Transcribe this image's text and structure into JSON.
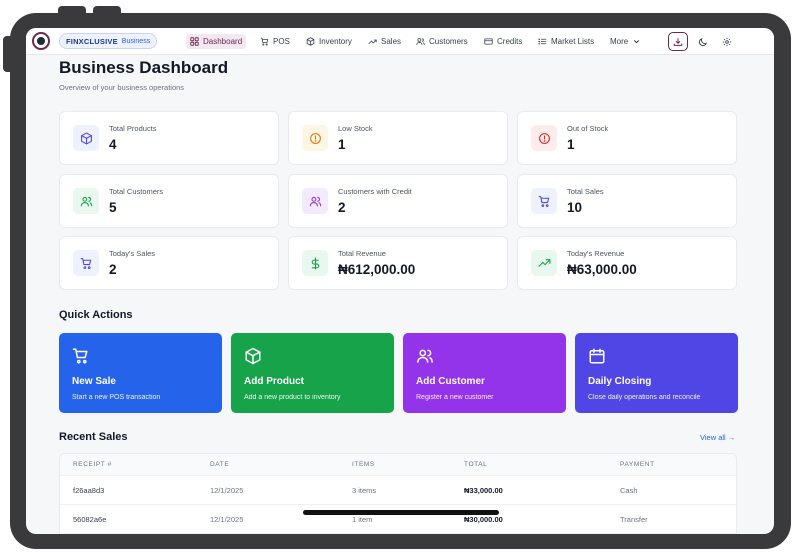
{
  "brand": {
    "name": "FINXCLUSIVE",
    "tag": "Business"
  },
  "nav": {
    "items": [
      {
        "label": "Dashboard",
        "icon": "dashboard-icon",
        "active": true
      },
      {
        "label": "POS",
        "icon": "cart-icon"
      },
      {
        "label": "Inventory",
        "icon": "box-icon"
      },
      {
        "label": "Sales",
        "icon": "trend-icon"
      },
      {
        "label": "Customers",
        "icon": "users-icon"
      },
      {
        "label": "Credits",
        "icon": "credit-card-icon"
      },
      {
        "label": "Market Lists",
        "icon": "list-icon"
      },
      {
        "label": "More",
        "icon": "chevron-down-icon"
      }
    ],
    "actions": [
      "download-icon",
      "moon-icon",
      "gear-icon"
    ]
  },
  "header": {
    "title": "Business Dashboard",
    "subtitle": "Overview of your business operations"
  },
  "stats": [
    {
      "label": "Total Products",
      "value": "4",
      "icon": "box-icon",
      "color": "#4f46e5",
      "bg": "#eef2ff"
    },
    {
      "label": "Low Stock",
      "value": "1",
      "icon": "alert-circle-icon",
      "color": "#d97706",
      "bg": "#fef6e4"
    },
    {
      "label": "Out of Stock",
      "value": "1",
      "icon": "alert-circle-icon",
      "color": "#dc2626",
      "bg": "#fdecec"
    },
    {
      "label": "Total Customers",
      "value": "5",
      "icon": "users-icon",
      "color": "#16a34a",
      "bg": "#e9f8ee"
    },
    {
      "label": "Customers with Credit",
      "value": "2",
      "icon": "users-icon",
      "color": "#9333ea",
      "bg": "#f4eafd"
    },
    {
      "label": "Total Sales",
      "value": "10",
      "icon": "cart-icon",
      "color": "#4f46e5",
      "bg": "#eef2ff"
    },
    {
      "label": "Today's Sales",
      "value": "2",
      "icon": "cart-icon",
      "color": "#4f46e5",
      "bg": "#eef2ff"
    },
    {
      "label": "Total Revenue",
      "value": "₦612,000.00",
      "icon": "dollar-icon",
      "color": "#16a34a",
      "bg": "#e9f8ee"
    },
    {
      "label": "Today's Revenue",
      "value": "₦63,000.00",
      "icon": "trend-up-icon",
      "color": "#16a34a",
      "bg": "#e9f8ee"
    }
  ],
  "quick_actions": {
    "title": "Quick Actions",
    "items": [
      {
        "title": "New Sale",
        "subtitle": "Start a new POS transaction",
        "icon": "cart-icon",
        "color": "#2563eb"
      },
      {
        "title": "Add Product",
        "subtitle": "Add a new product to inventory",
        "icon": "box-icon",
        "color": "#16a34a"
      },
      {
        "title": "Add Customer",
        "subtitle": "Register a new customer",
        "icon": "users-icon",
        "color": "#9333ea"
      },
      {
        "title": "Daily Closing",
        "subtitle": "Close daily operations and reconcile",
        "icon": "calendar-icon",
        "color": "#4f46e5"
      }
    ]
  },
  "recent_sales": {
    "title": "Recent Sales",
    "view_all": "View all →",
    "columns": [
      "RECEIPT #",
      "DATE",
      "ITEMS",
      "TOTAL",
      "PAYMENT"
    ],
    "rows": [
      {
        "receipt": "f26aa8d3",
        "date": "12/1/2025",
        "items": "3 items",
        "total": "₦33,000.00",
        "payment": "Cash"
      },
      {
        "receipt": "56082a6e",
        "date": "12/1/2025",
        "items": "1 item",
        "total": "₦30,000.00",
        "payment": "Transfer"
      }
    ]
  }
}
